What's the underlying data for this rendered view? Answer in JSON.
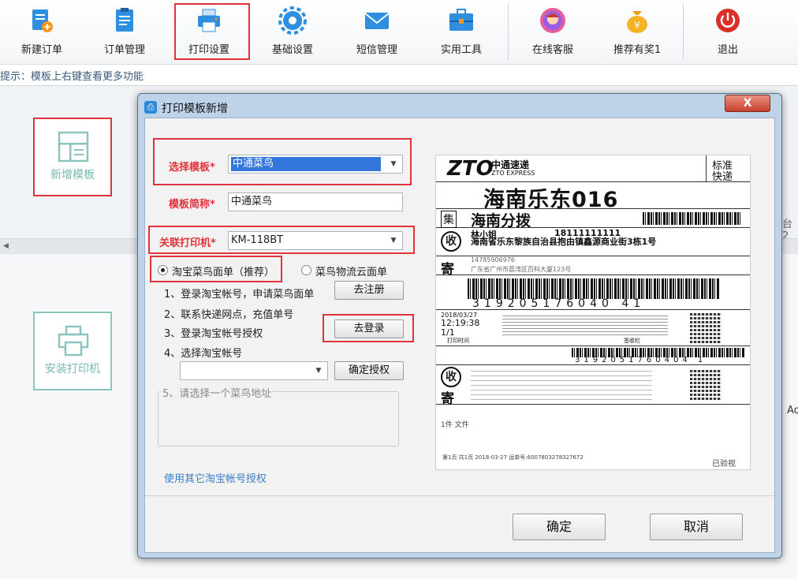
{
  "toolbar": {
    "items": [
      {
        "label": "新建订单",
        "icon": "new-order-icon"
      },
      {
        "label": "订单管理",
        "icon": "order-list-icon"
      },
      {
        "label": "打印设置",
        "icon": "printer-icon"
      },
      {
        "label": "基础设置",
        "icon": "gear-icon"
      },
      {
        "label": "短信管理",
        "icon": "mail-icon"
      },
      {
        "label": "实用工具",
        "icon": "toolbox-icon"
      },
      {
        "label": "在线客服",
        "icon": "support-icon"
      },
      {
        "label": "推荐有奖1",
        "icon": "money-bag-icon"
      },
      {
        "label": "退出",
        "icon": "power-icon"
      }
    ]
  },
  "hint": "提示：模板上右键查看更多功能",
  "background": {
    "add_template": "新增模板",
    "install_printer": "安装打印机",
    "side_text_1": "台2",
    "side_text_2": "Ac"
  },
  "dialog": {
    "title": "打印模板新增",
    "close": "X",
    "template_label": "选择模板*",
    "template_value": "中通菜鸟",
    "alias_label": "模板简称*",
    "alias_value": "中通菜鸟",
    "printer_label": "关联打印机*",
    "printer_value": "KM-118BT",
    "radio_taobao": "淘宝菜鸟面单（推荐）",
    "radio_cloud": "菜鸟物流云面单",
    "step1": "1、登录淘宝帐号，申请菜鸟面单",
    "register_btn": "去注册",
    "step2": "2、联系快递网点，充值单号",
    "step3": "3、登录淘宝帐号授权",
    "login_btn": "去登录",
    "step4": "4、选择淘宝帐号",
    "account_value": "",
    "confirm_auth_btn": "确定授权",
    "step5": "5、请选择一个菜鸟地址",
    "other_account_link": "使用其它淘宝帐号授权",
    "ok_btn": "确定",
    "cancel_btn": "取消"
  },
  "label_preview": {
    "brand": "中通速递",
    "brand_en": "ZTO EXPRESS",
    "std": "标准",
    "std2": "快递",
    "dest": "海南乐东016",
    "collect_tag": "集",
    "hub": "海南分拨",
    "recv_tag": "收",
    "recv_name": "林小姐",
    "recv_phone": "18111111111",
    "recv_addr": "海南省乐东黎族自治县抱由镇鑫源商业街3栋1号",
    "send_tag": "寄",
    "sender_phone": "14785906976",
    "sender_addr": "广东省广州市荔湾区百科大厦123号",
    "tracking": "319205176040 41",
    "date": "2018/03/27",
    "time": "12:19:38",
    "pieces": "1/1",
    "print_time": "打印时间",
    "signed": "签收栏",
    "tracking2": "3192051760404 1",
    "doc": "1件  文件",
    "footer": "第1页  共1页  2018-03-27  运单号:6007803278327672",
    "checked": "已验视"
  }
}
